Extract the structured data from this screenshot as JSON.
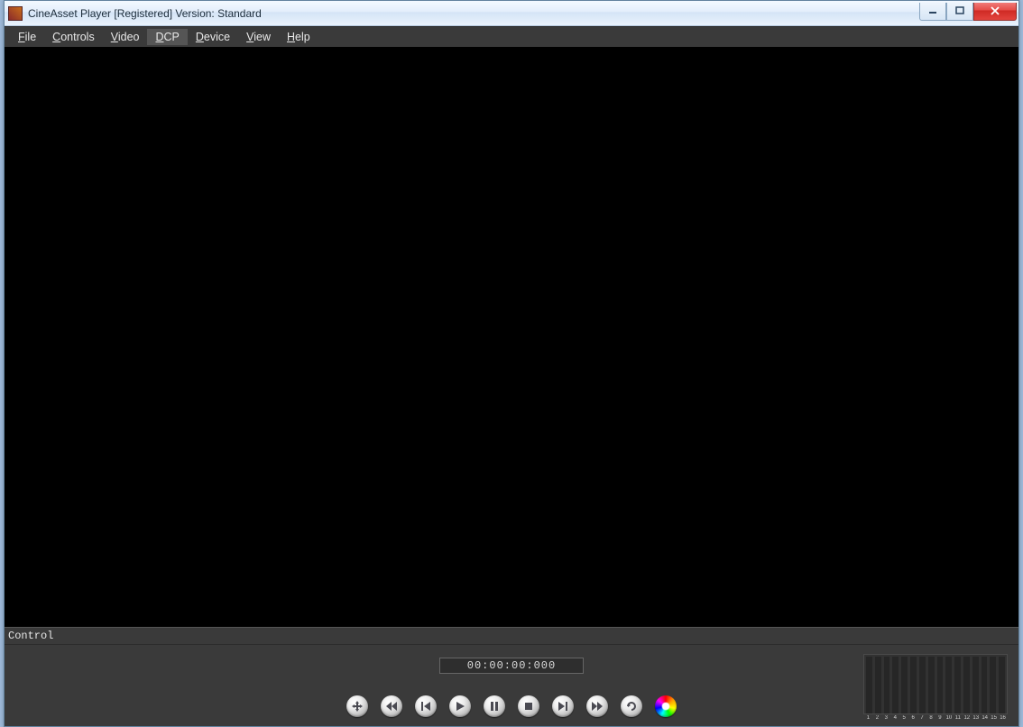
{
  "window": {
    "title": "CineAsset Player [Registered] Version: Standard"
  },
  "menubar": {
    "items": [
      {
        "label": "File",
        "hotkey_index": 0,
        "selected": false
      },
      {
        "label": "Controls",
        "hotkey_index": 0,
        "selected": false
      },
      {
        "label": "Video",
        "hotkey_index": 0,
        "selected": false
      },
      {
        "label": "DCP",
        "hotkey_index": 0,
        "selected": true
      },
      {
        "label": "Device",
        "hotkey_index": 0,
        "selected": false
      },
      {
        "label": "View",
        "hotkey_index": 0,
        "selected": false
      },
      {
        "label": "Help",
        "hotkey_index": 0,
        "selected": false
      }
    ]
  },
  "control_panel": {
    "header": "Control",
    "timecode": "00:00:00:000",
    "transport_buttons": [
      {
        "name": "move-button",
        "icon": "move"
      },
      {
        "name": "skip-back-button",
        "icon": "skip-back"
      },
      {
        "name": "step-back-button",
        "icon": "step-back"
      },
      {
        "name": "play-button",
        "icon": "play"
      },
      {
        "name": "pause-button",
        "icon": "pause"
      },
      {
        "name": "stop-button",
        "icon": "stop"
      },
      {
        "name": "step-forward-button",
        "icon": "step-fwd"
      },
      {
        "name": "skip-forward-button",
        "icon": "skip-fwd"
      },
      {
        "name": "loop-button",
        "icon": "loop"
      },
      {
        "name": "color-wheel-button",
        "icon": "colorwheel"
      }
    ],
    "audio_channels": [
      "1",
      "2",
      "3",
      "4",
      "5",
      "6",
      "7",
      "8",
      "9",
      "10",
      "11",
      "12",
      "13",
      "14",
      "15",
      "16"
    ]
  }
}
